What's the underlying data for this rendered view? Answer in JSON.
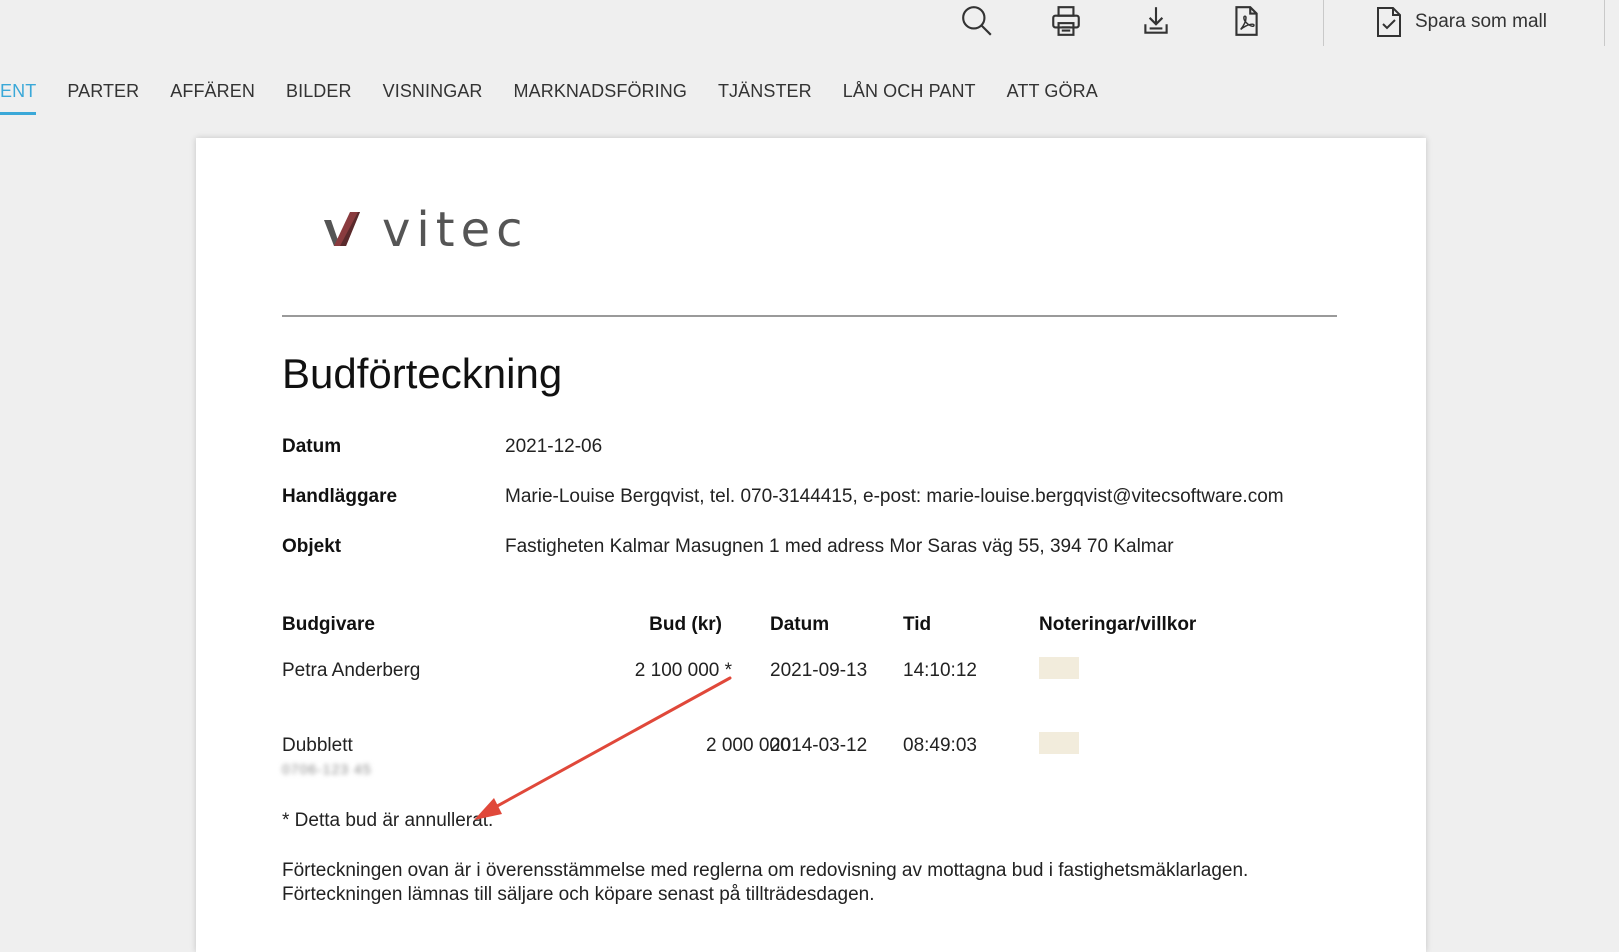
{
  "toolbar": {
    "icons": [
      "search-icon",
      "print-icon",
      "download-icon",
      "pdf-icon"
    ],
    "save_template_label": "Spara som mall",
    "save_template_icon": "document-check-icon"
  },
  "tabs": [
    {
      "label": "ENT",
      "active": true
    },
    {
      "label": "PARTER"
    },
    {
      "label": "AFFÄREN"
    },
    {
      "label": "BILDER"
    },
    {
      "label": "VISNINGAR"
    },
    {
      "label": "MARKNADSFÖRING"
    },
    {
      "label": "TJÄNSTER"
    },
    {
      "label": "LÅN OCH PANT"
    },
    {
      "label": "ATT GÖRA"
    }
  ],
  "document": {
    "logo_text": "vitec",
    "title": "Budförteckning",
    "info": {
      "datum_label": "Datum",
      "datum_value": "2021-12-06",
      "handlaggare_label": "Handläggare",
      "handlaggare_value": "Marie-Louise Bergqvist, tel. 070-3144415, e-post: marie-louise.bergqvist@vitecsoftware.com",
      "objekt_label": "Objekt",
      "objekt_value": "Fastigheten Kalmar Masugnen 1 med adress Mor Saras väg 55, 394 70 Kalmar"
    },
    "bid_table": {
      "headers": {
        "bidder": "Budgivare",
        "amount": "Bud (kr)",
        "date": "Datum",
        "time": "Tid",
        "notes": "Noteringar/villkor"
      },
      "rows": [
        {
          "bidder": "Petra Anderberg",
          "amount": "2 100 000 *",
          "date": "2021-09-13",
          "time": "14:10:12",
          "phone": ""
        },
        {
          "bidder": "Dubblett",
          "amount": "2 000 000",
          "date": "2014-03-12",
          "time": "08:49:03",
          "phone": "0706-123 45"
        }
      ]
    },
    "footnote": "* Detta bud är annullerat.",
    "footer_line1": "Förteckningen ovan är i överensstämmelse med reglerna om redovisning av mottagna bud i fastighetsmäklarlagen.",
    "footer_line2": "Förteckningen lämnas till säljare och köpare senast på tillträdesdagen."
  },
  "colors": {
    "accent": "#3aa8d8",
    "logo_mark": "#8a3b3e",
    "arrow": "#e0483a",
    "note_box": "#f2ecdc"
  }
}
